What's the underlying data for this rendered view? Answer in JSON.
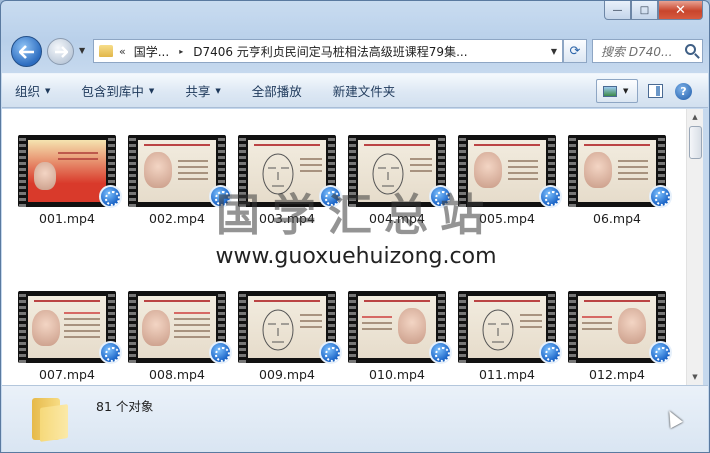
{
  "window": {
    "caption_buttons": {
      "minimize": "—",
      "maximize": "□",
      "close": "✕"
    }
  },
  "address_bar": {
    "chevron": "«",
    "crumb": "国学...",
    "separator": "▸",
    "path": "D7406 元亨利贞民间定马桩相法高级班课程79集...",
    "dropdown": "▼",
    "refresh": "⟳"
  },
  "search": {
    "placeholder": "搜索 D740..."
  },
  "toolbar": {
    "items": [
      {
        "label": "组织",
        "has_menu": true
      },
      {
        "label": "包含到库中",
        "has_menu": true
      },
      {
        "label": "共享",
        "has_menu": true
      },
      {
        "label": "全部播放",
        "has_menu": false
      },
      {
        "label": "新建文件夹",
        "has_menu": false
      }
    ],
    "menu_arrow": "▼",
    "help": "?"
  },
  "files": [
    {
      "name": "001.mp4",
      "art": "red"
    },
    {
      "name": "002.mp4",
      "art": "face-left"
    },
    {
      "name": "003.mp4",
      "art": "diagram"
    },
    {
      "name": "004.mp4",
      "art": "diagram"
    },
    {
      "name": "005.mp4",
      "art": "face-left"
    },
    {
      "name": "06.mp4",
      "art": "face-left"
    },
    {
      "name": "007.mp4",
      "art": "slide"
    },
    {
      "name": "008.mp4",
      "art": "slide"
    },
    {
      "name": "009.mp4",
      "art": "diagram"
    },
    {
      "name": "010.mp4",
      "art": "face-right"
    },
    {
      "name": "011.mp4",
      "art": "diagram"
    },
    {
      "name": "012.mp4",
      "art": "face-right"
    }
  ],
  "watermark": {
    "title": "国学汇总站",
    "url": "www.guoxuehuizong.com"
  },
  "details": {
    "count": "81 个对象"
  }
}
